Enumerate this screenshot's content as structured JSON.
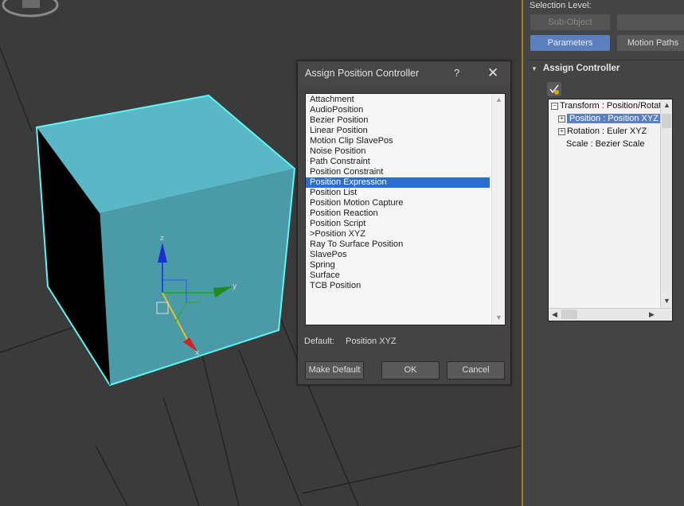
{
  "panel": {
    "selection_level_label": "Selection Level:",
    "sub_object_label": "Sub-Object",
    "parameters_label": "Parameters",
    "motion_paths_label": "Motion Paths",
    "rollout_title": "Assign Controller",
    "tree": [
      {
        "label": "Transform : Position/Rotat",
        "toggle": "minus",
        "selected": false
      },
      {
        "label": "Position : Position XYZ",
        "toggle": "plus",
        "selected": true
      },
      {
        "label": "Rotation : Euler XYZ",
        "toggle": "plus",
        "selected": false
      },
      {
        "label": "Scale : Bezier Scale",
        "toggle": "none",
        "selected": false
      }
    ]
  },
  "dialog": {
    "title": "Assign Position Controller",
    "help": "?",
    "close": "✕",
    "controllers": [
      "Attachment",
      "AudioPosition",
      "Bezier Position",
      "Linear Position",
      "Motion Clip SlavePos",
      "Noise Position",
      "Path Constraint",
      "Position Constraint",
      "Position Expression",
      "Position List",
      "Position Motion Capture",
      "Position Reaction",
      "Position Script",
      ">Position XYZ",
      "Ray To Surface Position",
      "SlavePos",
      "Spring",
      "Surface",
      "TCB Position"
    ],
    "selected_index": 8,
    "default_label": "Default:",
    "default_value": "Position XYZ",
    "make_default_label": "Make Default",
    "ok_label": "OK",
    "cancel_label": "Cancel"
  },
  "gizmo": {
    "x_label": "x",
    "y_label": "y",
    "z_label": "z"
  },
  "colors": {
    "selection": "#2a6fd0",
    "active_tab": "#5b7fbf",
    "cube_face": "#4fa7b5",
    "cube_edge": "#5ff5f5",
    "panel_accent": "#b07a1a"
  }
}
